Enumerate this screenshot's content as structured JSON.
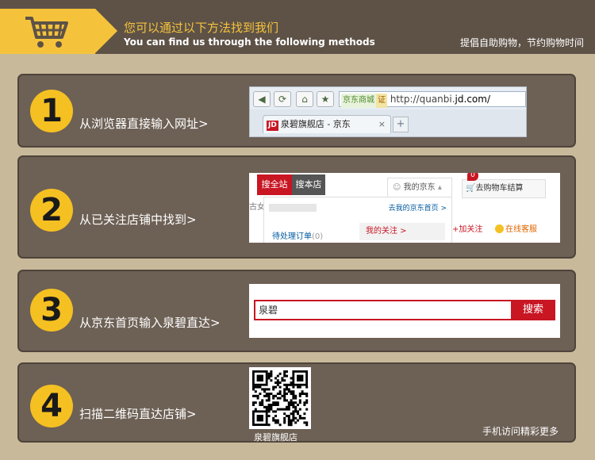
{
  "header": {
    "title_cn": "您可以通过以下方法找到我们",
    "title_en": "You can find us through the following methods",
    "slogan": "提倡自助购物，节约购物时间",
    "cart_icon": "shopping-cart-icon",
    "colors": {
      "bar": "#5e5247",
      "accent": "#f5c33b",
      "panel": "#6d6055",
      "page": "#c8b99a"
    }
  },
  "steps": [
    {
      "number": "1",
      "label": "从浏览器直接输入网址>"
    },
    {
      "number": "2",
      "label": "从已关注店铺中找到>"
    },
    {
      "number": "3",
      "label": "从京东首页输入泉碧直达>"
    },
    {
      "number": "4",
      "label": "扫描二维码直达店铺>"
    }
  ],
  "browser": {
    "site_tag": "京东商城",
    "cert_tag": "证",
    "url_prefix": "http://quanbi.",
    "url_host": "jd.com/",
    "tab_logo": "JD",
    "tab_title": "泉碧旗舰店 - 京东",
    "tab_close": "×",
    "new_tab": "+",
    "back_icon": "back-arrow-icon",
    "reload_icon": "reload-icon",
    "home_icon": "home-icon",
    "bookmark_icon": "star-icon"
  },
  "follow": {
    "search_all": "搜全站",
    "search_store": "搜本店",
    "left_fragment": "古女",
    "my_jd": "我的京东",
    "home_link": "去我的京东首页 >",
    "pending_orders": "待处理订单",
    "pending_count": "(0)",
    "my_follow": "我的关注 >",
    "cart_badge": "0",
    "cart": "去购物车结算",
    "add_follow": "+加关注",
    "online_service": "在线客服"
  },
  "search": {
    "query": "泉碧",
    "button": "搜索"
  },
  "qr": {
    "caption": "泉碧旗舰店",
    "more": "手机访问精彩更多"
  }
}
